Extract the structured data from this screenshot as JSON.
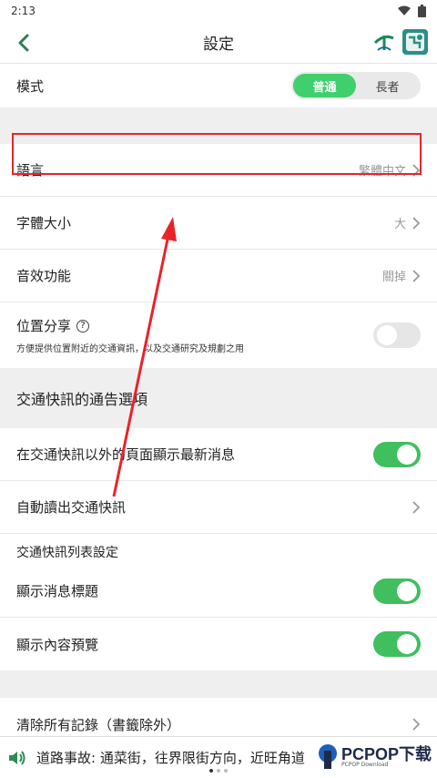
{
  "status": {
    "time": "2:13"
  },
  "app_bar": {
    "title": "設定"
  },
  "mode": {
    "label": "模式",
    "options": [
      "普通",
      "長者"
    ],
    "selected": "普通"
  },
  "settings": [
    {
      "label": "語言",
      "value": "繁體中文"
    },
    {
      "label": "字體大小",
      "value": "大"
    },
    {
      "label": "音效功能",
      "value": "關掉"
    }
  ],
  "location_share": {
    "label": "位置分享",
    "help": "?",
    "description": "方便提供位置附近的交通資訊，以及交通研究及規劃之用",
    "enabled": false
  },
  "notice_section": {
    "header": "交通快訊的通告選項",
    "show_latest": {
      "label": "在交通快訊以外的頁面顯示最新消息",
      "enabled": true
    },
    "auto_read": {
      "label": "自動讀出交通快訊"
    },
    "list_settings_title": "交通快訊列表設定",
    "show_title": {
      "label": "顯示消息標題",
      "enabled": true
    },
    "show_preview": {
      "label": "顯示內容預覽",
      "enabled": true
    }
  },
  "clear": {
    "label": "清除所有記錄（書籤除外）"
  },
  "ticker": {
    "text": "道路事故: 通菜街，往界限街方向，近旺角道"
  },
  "watermark": {
    "brand": "PCPOP下载",
    "sub": "PCPOP Download"
  },
  "colors": {
    "accent_green": "#3fcf6c",
    "highlight_red": "#e8242a"
  }
}
